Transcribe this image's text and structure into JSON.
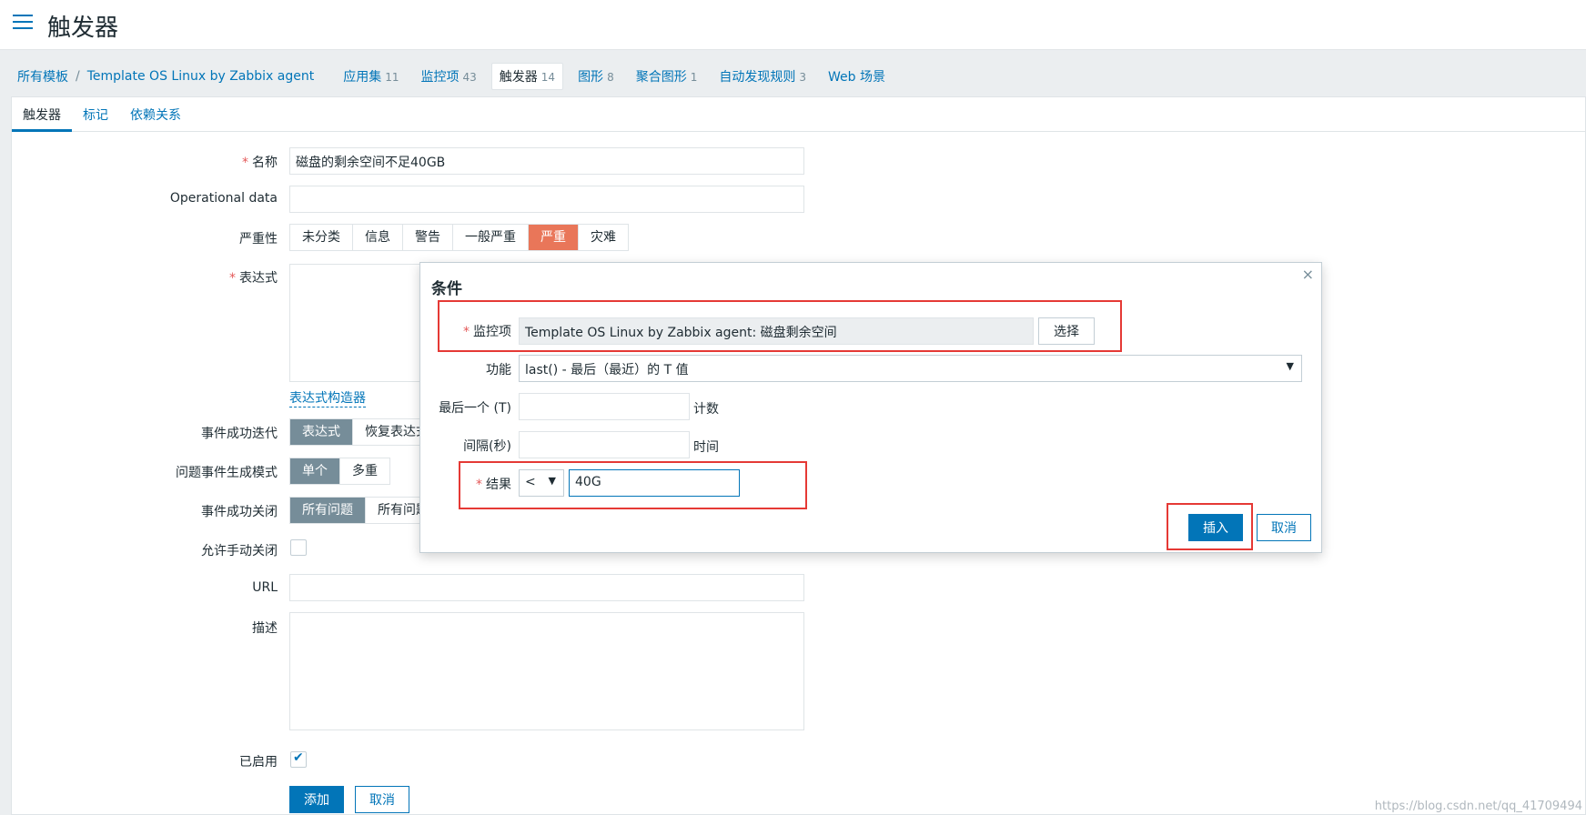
{
  "header": {
    "title": "触发器"
  },
  "breadcrumb": {
    "root": "所有模板",
    "separator": "/",
    "template": "Template OS Linux by Zabbix agent",
    "nav": [
      {
        "label": "应用集",
        "count": "11"
      },
      {
        "label": "监控项",
        "count": "43"
      },
      {
        "label": "触发器",
        "count": "14"
      },
      {
        "label": "图形",
        "count": "8"
      },
      {
        "label": "聚合图形",
        "count": "1"
      },
      {
        "label": "自动发现规则",
        "count": "3"
      },
      {
        "label": "Web 场景",
        "count": ""
      }
    ]
  },
  "tabs": [
    "触发器",
    "标记",
    "依赖关系"
  ],
  "form": {
    "name_label": "名称",
    "name_value": "磁盘的剩余空间不足40GB",
    "opdata_label": "Operational data",
    "opdata_value": "",
    "severity_label": "严重性",
    "severity_options": [
      "未分类",
      "信息",
      "警告",
      "一般严重",
      "严重",
      "灾难"
    ],
    "severity_selected": "严重",
    "expression_label": "表达式",
    "expression_builder": "表达式构造器",
    "ok_event_label": "事件成功迭代",
    "ok_event_options": [
      "表达式",
      "恢复表达式"
    ],
    "problem_mode_label": "问题事件生成模式",
    "problem_mode_options": [
      "单个",
      "多重"
    ],
    "ok_close_label": "事件成功关闭",
    "ok_close_options": [
      "所有问题",
      "所有问题"
    ],
    "manual_close_label": "允许手动关闭",
    "url_label": "URL",
    "desc_label": "描述",
    "enabled_label": "已启用",
    "add_button": "添加",
    "cancel_button": "取消"
  },
  "dialog": {
    "title": "条件",
    "close": "×",
    "item_label": "监控项",
    "item_value": "Template OS Linux by Zabbix agent: 磁盘剩余空间",
    "select_button": "选择",
    "function_label": "功能",
    "function_value": "last() - 最后（最近）的 T 值",
    "last_t_label": "最后一个 (T)",
    "last_t_unit": "计数",
    "interval_label": "间隔(秒)",
    "interval_unit": "时间",
    "result_label": "结果",
    "operator_value": "<",
    "result_value": "40G",
    "insert_button": "插入",
    "cancel_button": "取消"
  },
  "watermark": "https://blog.csdn.net/qq_41709494",
  "colors": {
    "accent": "#0275b8",
    "high_severity": "#e97659",
    "highlight_box": "#e53935"
  }
}
